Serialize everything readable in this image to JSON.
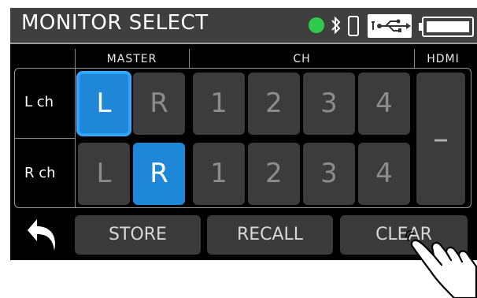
{
  "title": "MONITOR SELECT",
  "status_icons": {
    "power": "green-circle-icon",
    "bluetooth": "bluetooth-icon",
    "phone": "phone-icon",
    "usb": "usb-icon",
    "battery": "battery-icon",
    "power_color": "#2ecc4a"
  },
  "header": {
    "master": "MASTER",
    "ch": "CH",
    "hdmi": "HDMI"
  },
  "rows": [
    {
      "label": "L ch",
      "keys": [
        "L",
        "R",
        "1",
        "2",
        "3",
        "4"
      ]
    },
    {
      "label": "R ch",
      "keys": [
        "L",
        "R",
        "1",
        "2",
        "3",
        "4"
      ]
    }
  ],
  "hdmi_value": "–",
  "selected": {
    "row1": "L",
    "row2": "R"
  },
  "buttons": {
    "store": "STORE",
    "recall": "RECALL",
    "clear": "CLEAR"
  },
  "colors": {
    "accent": "#1e87d8",
    "key_bg": "#3c3c3c"
  }
}
